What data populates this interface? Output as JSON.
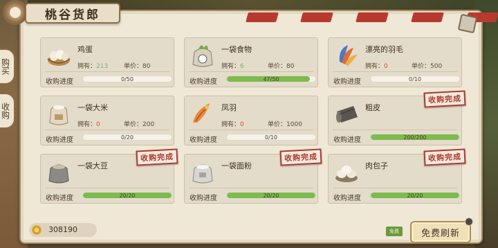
{
  "title": "桃谷货郎",
  "side_tabs": [
    "购买",
    "收购"
  ],
  "labels": {
    "owned": "拥有：",
    "price": "单价：",
    "progress": "收购进度",
    "complete_stamp": "收购完成",
    "free_tag": "免费"
  },
  "items": [
    {
      "name": "鸡蛋",
      "owned": "213",
      "price": "80",
      "progress": "0/50",
      "pct": 0,
      "done": false,
      "icon": "egg-basket-icon"
    },
    {
      "name": "一袋食物",
      "owned": "6",
      "price": "80",
      "progress": "47/50",
      "pct": 0.94,
      "done": false,
      "icon": "food-bag-icon"
    },
    {
      "name": "漂亮的羽毛",
      "owned": "0",
      "price": "500",
      "progress": "0/10",
      "pct": 0,
      "done": false,
      "icon": "feather-bundle-icon"
    },
    {
      "name": "一袋大米",
      "owned": "0",
      "price": "200",
      "progress": "0/20",
      "pct": 0,
      "done": false,
      "icon": "rice-sack-icon"
    },
    {
      "name": "凤羽",
      "owned": "0",
      "price": "1000",
      "progress": "0/10",
      "pct": 0,
      "done": false,
      "icon": "phoenix-feather-icon"
    },
    {
      "name": "粗皮",
      "owned": "",
      "price": "",
      "progress": "200/200",
      "pct": 1,
      "done": true,
      "icon": "leather-roll-icon"
    },
    {
      "name": "一袋大豆",
      "owned": "",
      "price": "",
      "progress": "20/20",
      "pct": 1,
      "done": true,
      "icon": "soybean-sack-icon"
    },
    {
      "name": "一袋面粉",
      "owned": "",
      "price": "",
      "progress": "20/20",
      "pct": 1,
      "done": true,
      "icon": "flour-sack-icon"
    },
    {
      "name": "肉包子",
      "owned": "",
      "price": "",
      "progress": "20/20",
      "pct": 1,
      "done": true,
      "icon": "steamed-bun-icon"
    }
  ],
  "coins": "308190",
  "refresh_label": "免费刷新",
  "colors": {
    "progress_fill": "#7dbb4f",
    "stamp": "#a83a30",
    "owned_zero": "#d24a3e",
    "owned_pos": "#7bb070"
  }
}
